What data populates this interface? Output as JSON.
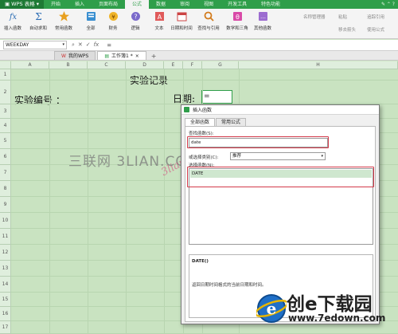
{
  "app": {
    "badge": "WPS 表格"
  },
  "menu": {
    "items": [
      "开始",
      "插入",
      "页面布局",
      "公式",
      "数据",
      "审阅",
      "视图",
      "开发工具",
      "特色功能"
    ],
    "active_index": 3,
    "right_icons": "✎ ⌃ ?"
  },
  "ribbon": {
    "buttons": [
      {
        "label": "插入函数",
        "icon": "fx-icon"
      },
      {
        "label": "自动求和",
        "icon": "sigma-icon"
      },
      {
        "label": "常用函数",
        "icon": "star-icon"
      },
      {
        "label": "全部",
        "icon": "book-icon"
      },
      {
        "label": "财务",
        "icon": "coin-icon"
      },
      {
        "label": "逻辑",
        "icon": "question-icon"
      },
      {
        "label": "文本",
        "icon": "text-icon"
      },
      {
        "label": "日期和时间",
        "icon": "calendar-icon"
      },
      {
        "label": "查找与引用",
        "icon": "search-icon"
      },
      {
        "label": "数学和三角",
        "icon": "math-icon"
      },
      {
        "label": "其他函数",
        "icon": "dots-icon"
      }
    ],
    "side_labels": [
      "名称管理器",
      "粘贴",
      "追踪引用",
      "移去箭头",
      "追踪从属",
      "使用公式"
    ]
  },
  "formula_bar": {
    "name_box": "WEEKDAY",
    "formula": "="
  },
  "doc_tabs": [
    {
      "label": "我的WPS"
    },
    {
      "label": "工作簿1 *"
    }
  ],
  "columns": [
    "A",
    "B",
    "C",
    "D",
    "E",
    "F",
    "G",
    "H"
  ],
  "rows": [
    "1",
    "2",
    "3",
    "4",
    "5",
    "6",
    "7",
    "8",
    "9",
    "10",
    "11",
    "12",
    "13",
    "14",
    "15",
    "16",
    "17",
    "18",
    "19",
    "20"
  ],
  "cells": {
    "title": "实验记录",
    "experiment_no": "实验编号 ：",
    "date_label": "日期:",
    "date_value": "="
  },
  "watermark": "三联网 3LIAN.COM",
  "watermark2": "3lian.com",
  "dialog": {
    "title": "插入函数",
    "tabs": [
      "全部函数",
      "常用公式"
    ],
    "active_tab": 0,
    "search_label": "查找函数(S):",
    "search_value": "date",
    "category_label": "或选择类别(C):",
    "category_value": "推荐",
    "select_label": "选择函数(N):",
    "selected_function": "DATE",
    "desc_title": "DATE()",
    "desc_text": "返回日期时间格式的当前日期和时间。"
  },
  "logo": {
    "text": "创e下载园",
    "url": "www.7edown.com"
  },
  "colors": {
    "accent": "#2f9e4a",
    "highlight": "#d33a4a",
    "grid_bg": "#c9e3c1"
  }
}
